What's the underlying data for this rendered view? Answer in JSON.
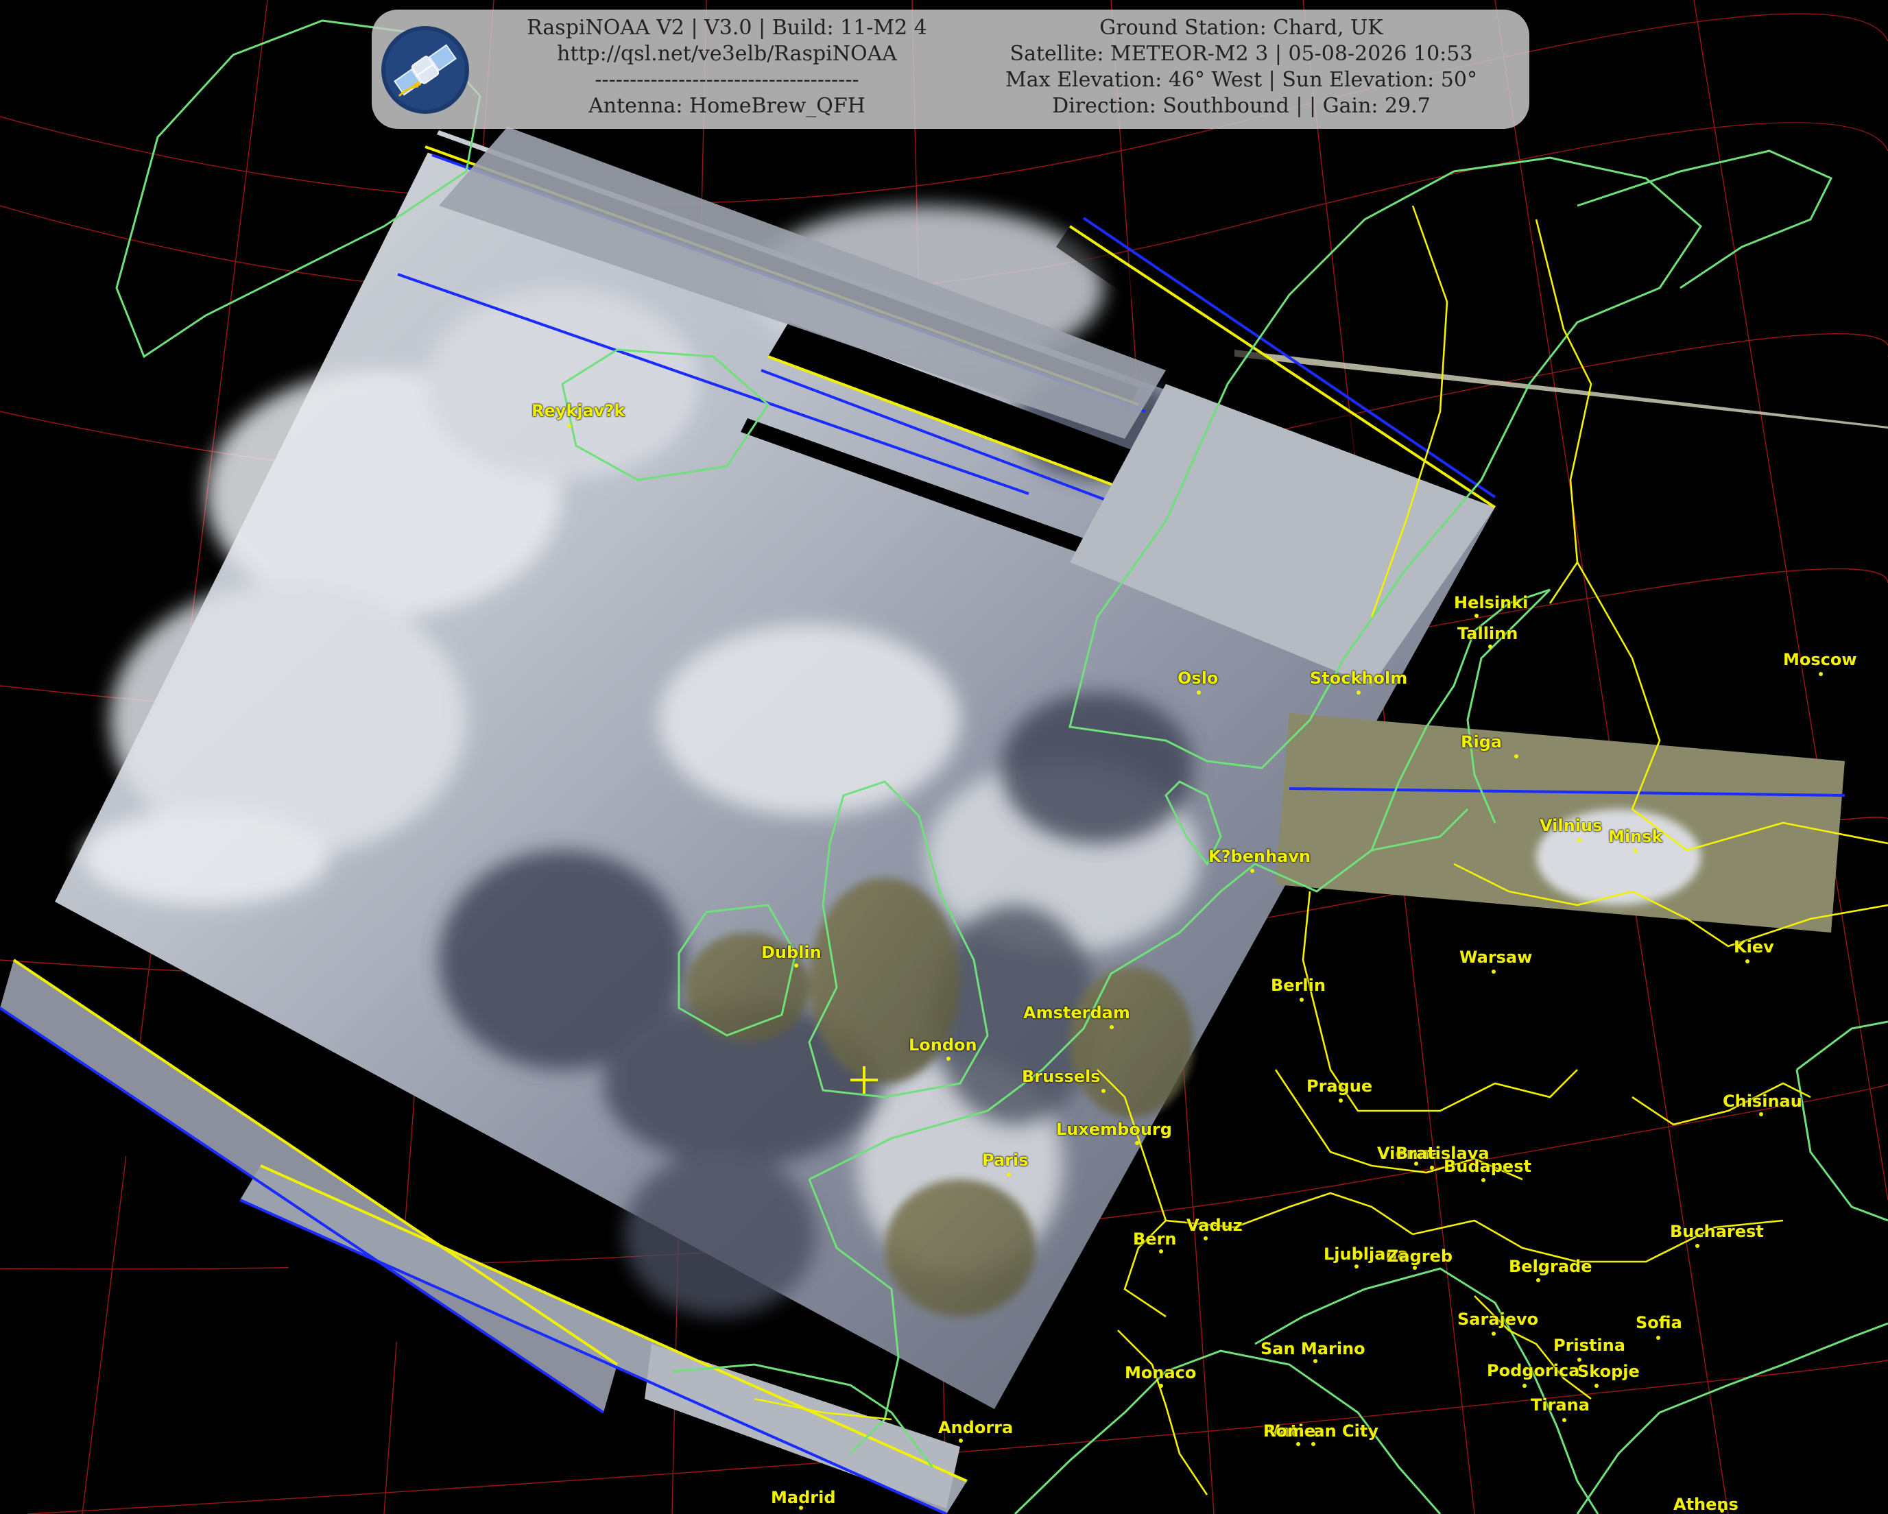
{
  "header": {
    "left_lines": [
      "RaspiNOAA V2 | V3.0 | Build: 11-M2 4",
      "http://qsl.net/ve3elb/RaspiNOAA",
      "--------------------------------------",
      "Antenna: HomeBrew_QFH"
    ],
    "right_lines": [
      "Ground Station: Chard, UK",
      "Satellite: METEOR-M2 3 | 05-08-2026 10:53",
      "Max Elevation: 46° West | Sun Elevation: 50°",
      "Direction: Southbound | | Gain: 29.7"
    ]
  },
  "logo": {
    "icon": "satellite-icon",
    "bg_color": "#1d3a6e",
    "accent_color": "#f5c400"
  },
  "colors": {
    "coastline": "#6fe07a",
    "border": "#f2f200",
    "graticule": "#b01818",
    "city_label": "#f2f200",
    "background": "#000000",
    "header_bg": "#c8c8c8"
  },
  "cities": [
    {
      "name": "Reykjav?k"
    },
    {
      "name": "Helsinki"
    },
    {
      "name": "Tallinn"
    },
    {
      "name": "Moscow"
    },
    {
      "name": "Oslo"
    },
    {
      "name": "Stockholm"
    },
    {
      "name": "Riga"
    },
    {
      "name": "Vilnius"
    },
    {
      "name": "Minsk"
    },
    {
      "name": "K?benhavn"
    },
    {
      "name": "Dublin"
    },
    {
      "name": "Warsaw"
    },
    {
      "name": "Kiev"
    },
    {
      "name": "Berlin"
    },
    {
      "name": "Amsterdam"
    },
    {
      "name": "London"
    },
    {
      "name": "Brussels"
    },
    {
      "name": "Prague"
    },
    {
      "name": "Chisinau"
    },
    {
      "name": "Luxembourg"
    },
    {
      "name": "Vienna"
    },
    {
      "name": "Bratislava"
    },
    {
      "name": "Budapest"
    },
    {
      "name": "Paris"
    },
    {
      "name": "Bern"
    },
    {
      "name": "Vaduz"
    },
    {
      "name": "Bucharest"
    },
    {
      "name": "Ljubljana"
    },
    {
      "name": "Zagreb"
    },
    {
      "name": "Belgrade"
    },
    {
      "name": "Sarajevo"
    },
    {
      "name": "Sofia"
    },
    {
      "name": "San Marino"
    },
    {
      "name": "Pristina"
    },
    {
      "name": "Monaco"
    },
    {
      "name": "Podgorica"
    },
    {
      "name": "Skopje"
    },
    {
      "name": "Tirana"
    },
    {
      "name": "Andorra"
    },
    {
      "name": "Vatican City"
    },
    {
      "name": "Rome"
    },
    {
      "name": "Madrid"
    },
    {
      "name": "Athens"
    }
  ]
}
